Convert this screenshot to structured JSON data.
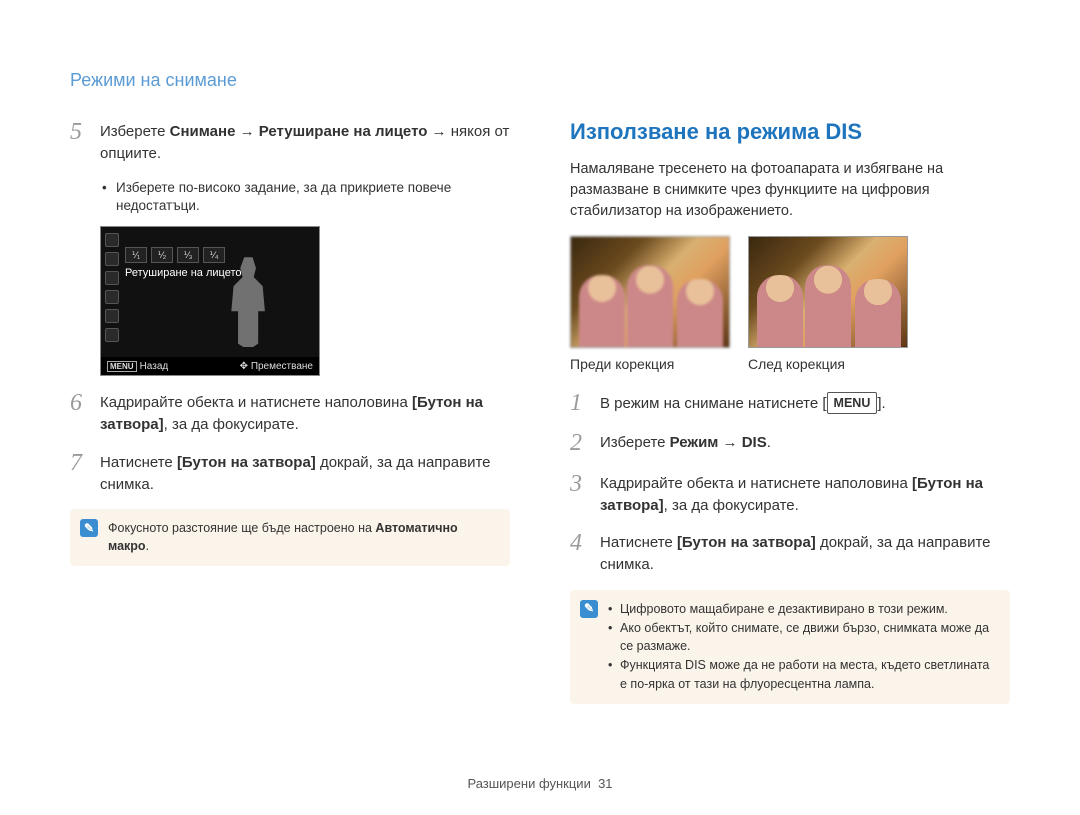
{
  "headerTitle": "Режими на снимане",
  "left": {
    "steps": {
      "s5": {
        "num": "5",
        "pre": "Изберете ",
        "bold": "Снимане → Ретуширане на лицето →",
        "post": " някоя от опциите."
      },
      "bullet5": "Изберете по-високо задание, за да прикриете повече недостатъци.",
      "s6": {
        "num": "6",
        "pre": "Кадрирайте обекта и натиснете наполовина ",
        "bold": "[Бутон на затвора]",
        "post": ", за да фокусирате."
      },
      "s7": {
        "num": "7",
        "pre": "Натиснете ",
        "bold": "[Бутон на затвора]",
        "post": " докрай, за да направите снимка."
      }
    },
    "lcd": {
      "label": "Ретуширане на лицето",
      "backKey": "MENU",
      "back": "Назад",
      "move": "Преместване",
      "cells": [
        "⅟₁",
        "⅟₂",
        "⅟₃",
        "⅟₄"
      ]
    },
    "noteSingle": {
      "pre": "Фокусното разстояние ще бъде настроено на ",
      "bold": "Автоматично макро",
      "post": "."
    }
  },
  "right": {
    "title": "Използване на режима DIS",
    "intro": "Намаляване тресенето на фотоапарата и избягване на размазване в снимките чрез функциите на цифровия стабилизатор на изображението.",
    "captionBefore": "Преди корекция",
    "captionAfter": "След корекция",
    "steps": {
      "s1": {
        "num": "1",
        "pre": "В режим на снимане натиснете [",
        "menu": "MENU",
        "post": "]."
      },
      "s2": {
        "num": "2",
        "pre": "Изберете ",
        "bold": "Режим → DIS",
        "post": "."
      },
      "s3": {
        "num": "3",
        "pre": "Кадрирайте обекта и натиснете наполовина ",
        "bold": "[Бутон на затвора]",
        "post": ", за да фокусирате."
      },
      "s4": {
        "num": "4",
        "pre": "Натиснете ",
        "bold": "[Бутон на затвора]",
        "post": " докрай, за да направите снимка."
      }
    },
    "notes": [
      "Цифровото мащабиране е дезактивирано в този режим.",
      "Ако обектът, който снимате, се движи бързо, снимката може да се размаже.",
      "Функцията DIS може да не работи на места, където светлината е по-ярка от тази на флуоресцентна лампа."
    ]
  },
  "footer": {
    "label": "Разширени функции",
    "page": "31"
  }
}
